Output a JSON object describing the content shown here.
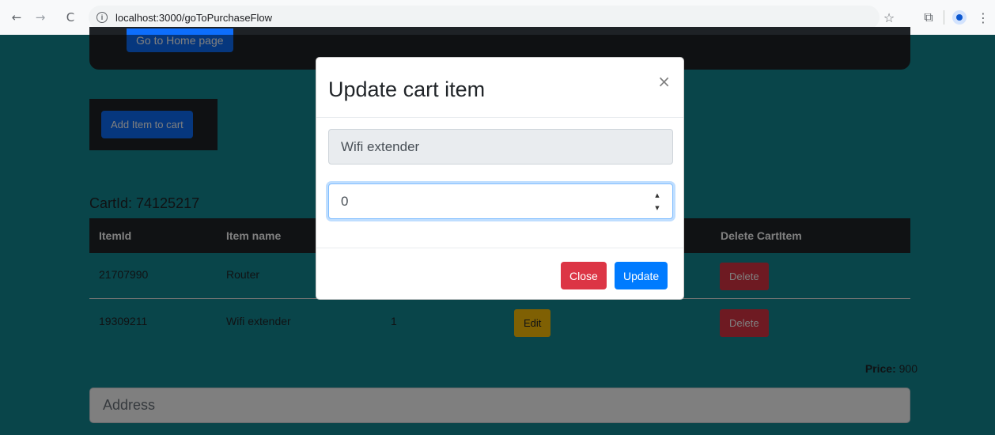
{
  "browser": {
    "url": "localhost:3000/goToPurchaseFlow",
    "back_icon": "←",
    "forward_icon": "→",
    "reload_icon": "C",
    "info_icon": "i",
    "star_icon": "☆",
    "extensions_icon": "⧉",
    "menu_icon": "⋮"
  },
  "page": {
    "home_button": "Go to Home page",
    "add_item_button": "Add Item to cart",
    "cart_id": "CartId: 74125217",
    "table": {
      "headers": [
        "ItemId",
        "Item name",
        "Delete CartItem"
      ],
      "rows": [
        {
          "item_id": "21707990",
          "item_name": "Router",
          "quantity": "",
          "delete": "Delete"
        },
        {
          "item_id": "19309211",
          "item_name": "Wifi extender",
          "quantity": "1",
          "edit": "Edit",
          "delete": "Delete"
        }
      ]
    },
    "price_label": "Price:",
    "price_value": "900",
    "address_placeholder": "Address"
  },
  "modal": {
    "title": "Update cart item",
    "close_icon": "×",
    "item_name_value": "Wifi extender",
    "quantity_value": "0",
    "close_button": "Close",
    "update_button": "Update"
  },
  "colors": {
    "page_bg": "#138a94",
    "primary": "#007bff",
    "danger": "#dc3545",
    "warning": "#ffc107",
    "dark": "#212529"
  }
}
